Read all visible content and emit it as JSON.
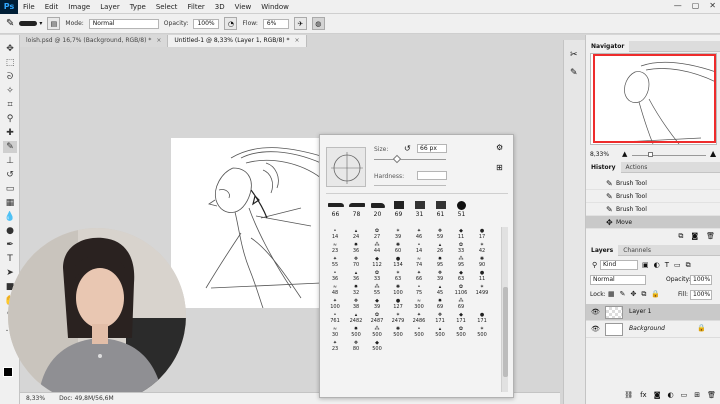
{
  "app": {
    "logo": "Ps"
  },
  "menu": [
    "File",
    "Edit",
    "Image",
    "Layer",
    "Type",
    "Select",
    "Filter",
    "3D",
    "View",
    "Window"
  ],
  "window_controls": [
    "—",
    "▢",
    "✕"
  ],
  "options": {
    "mode_label": "Mode:",
    "mode_value": "Normal",
    "opacity_label": "Opacity:",
    "opacity_value": "100%",
    "flow_label": "Flow:",
    "flow_value": "6%"
  },
  "tabs": [
    {
      "label": "loish.psd @ 16,7% (Background, RGB/8) *",
      "close": "×"
    },
    {
      "label": "Untitled-1 @ 8,33% (Layer 1, RGB/8) *",
      "close": "×"
    }
  ],
  "status": {
    "zoom": "8,33%",
    "doc": "Doc: 49,8M/56,6M"
  },
  "brush_popup": {
    "size_label": "Size:",
    "size_value": "66 px",
    "hardness_label": "Hardness:",
    "hardness_value": "",
    "recent_sizes": [
      "66",
      "78",
      "20",
      "69",
      "31",
      "61",
      "51"
    ],
    "grid_numbers": [
      "14",
      "24",
      "27",
      "39",
      "46",
      "59",
      "11",
      "17",
      "23",
      "36",
      "44",
      "60",
      "14",
      "26",
      "33",
      "42",
      "55",
      "70",
      "112",
      "134",
      "74",
      "95",
      "95",
      "90",
      "36",
      "36",
      "33",
      "63",
      "66",
      "39",
      "63",
      "11",
      "48",
      "32",
      "55",
      "100",
      "75",
      "45",
      "1106",
      "1499",
      "100",
      "38",
      "39",
      "127",
      "300",
      "69",
      "69",
      "",
      "761",
      "2482",
      "2487",
      "2479",
      "2486",
      "171",
      "171",
      "171",
      "30",
      "500",
      "500",
      "500",
      "500",
      "500",
      "500",
      "500",
      "23",
      "80",
      "500",
      "",
      "",
      "",
      "",
      ""
    ]
  },
  "panels": {
    "navigator_tab": "Navigator",
    "nav_zoom": "8,33%",
    "history_tabs": [
      "History",
      "Actions"
    ],
    "history_items": [
      "Brush Tool",
      "Brush Tool",
      "Brush Tool",
      "Move"
    ],
    "layers_tabs": [
      "Layers",
      "Channels"
    ],
    "kind_value": "Kind",
    "blend_value": "Normal",
    "opacity_label": "Opacity:",
    "opacity_value": "100%",
    "lock_label": "Lock:",
    "fill_label": "Fill:",
    "fill_value": "100%",
    "layers": [
      {
        "name": "Layer 1"
      },
      {
        "name": "Background"
      }
    ]
  },
  "colors": {
    "accent_red": "#ee2c2c",
    "ps_blue": "#31a8ff"
  }
}
